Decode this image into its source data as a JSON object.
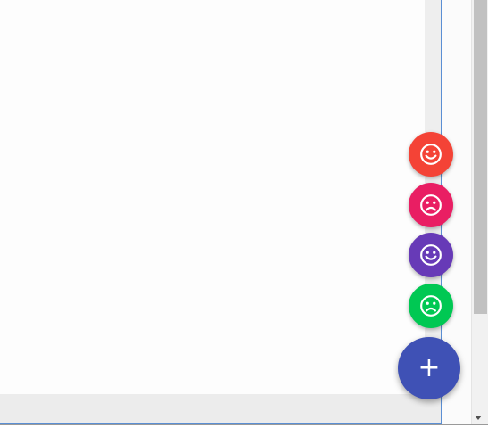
{
  "colors": {
    "fab_red": "#f44336",
    "fab_pink": "#e91e63",
    "fab_purple": "#673ab7",
    "fab_green": "#00c853",
    "fab_main": "#3f51b5",
    "frame_border": "#5b8fd4",
    "scroll_thumb": "#c1c1c1"
  },
  "fab_menu": {
    "items": [
      {
        "icon": "smile-icon",
        "color": "#f44336"
      },
      {
        "icon": "frown-icon",
        "color": "#e91e63"
      },
      {
        "icon": "smile-icon",
        "color": "#673ab7"
      },
      {
        "icon": "frown-icon",
        "color": "#00c853"
      }
    ],
    "main": {
      "icon": "plus-icon",
      "glyph": "+",
      "color": "#3f51b5"
    }
  }
}
